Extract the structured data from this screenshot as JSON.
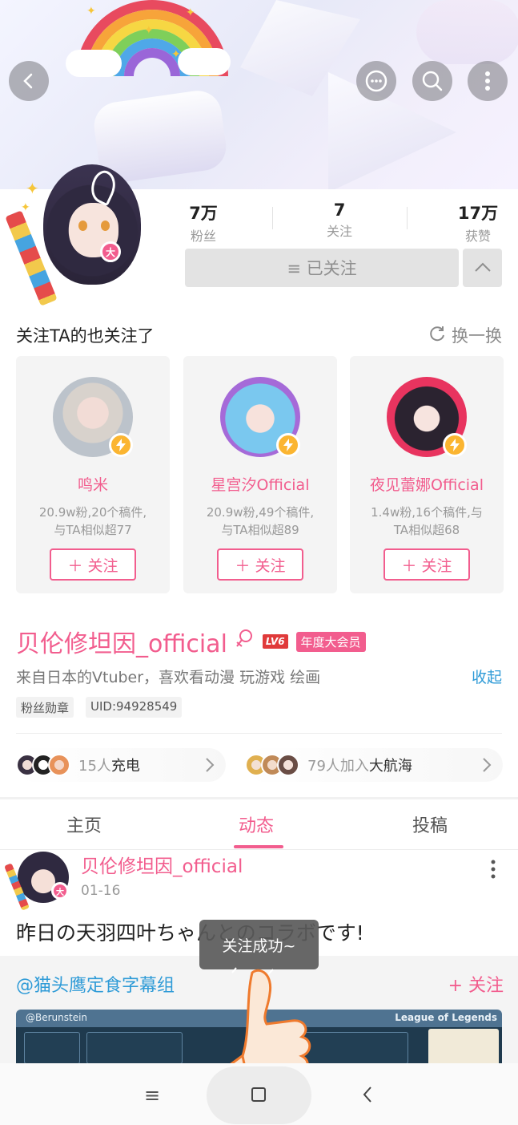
{
  "header": {
    "back_icon": "back-arrow-icon",
    "actions": [
      "chat-bubble-icon",
      "search-icon",
      "more-vertical-icon"
    ]
  },
  "profile": {
    "stats": [
      {
        "num": "7万",
        "label": "粉丝"
      },
      {
        "num": "7",
        "label": "关注"
      },
      {
        "num": "17万",
        "label": "获赞"
      }
    ],
    "follow_button": "≡ 已关注",
    "avatar_badge": "大",
    "name": "贝伦修坦因_official",
    "level": "LV6",
    "vip": "年度大会员",
    "bio": "来自日本的Vtuber，喜欢看动漫 玩游戏 绘画",
    "collapse": "收起",
    "tags": [
      "粉丝勋章",
      "UID:94928549"
    ],
    "charge": {
      "count": "15人",
      "label": "充电"
    },
    "fleet": {
      "count": "79人",
      "label": "加入",
      "bold": "大航海"
    }
  },
  "recommend": {
    "title": "关注TA的也关注了",
    "refresh": "换一换",
    "cards": [
      {
        "name": "鸣米",
        "desc": "20.9w粉,20个稿件,\n与TA相似超77",
        "follow": "关注"
      },
      {
        "name": "星宫汐Official",
        "desc": "20.9w粉,49个稿件,\n与TA相似超89",
        "follow": "关注"
      },
      {
        "name": "夜见蕾娜Official",
        "desc": "1.4w粉,16个稿件,与\nTA相似超68",
        "follow": "关注"
      }
    ]
  },
  "tabs": [
    {
      "label": "主页",
      "active": false
    },
    {
      "label": "动态",
      "active": true
    },
    {
      "label": "投稿",
      "active": false
    }
  ],
  "post": {
    "author": "贝伦修坦因_official",
    "date": "01-16",
    "text": "昨日の天羽四叶ちゃんとのコラボです!",
    "shared_user": "@猫头鹰定食字幕组",
    "shared_follow": "+ 关注",
    "embed_left": "@Berunstein",
    "embed_right": "League of Legends"
  },
  "toast": "关注成功~",
  "colors": {
    "accent": "#f25d8e",
    "link": "#2f9bd7"
  }
}
